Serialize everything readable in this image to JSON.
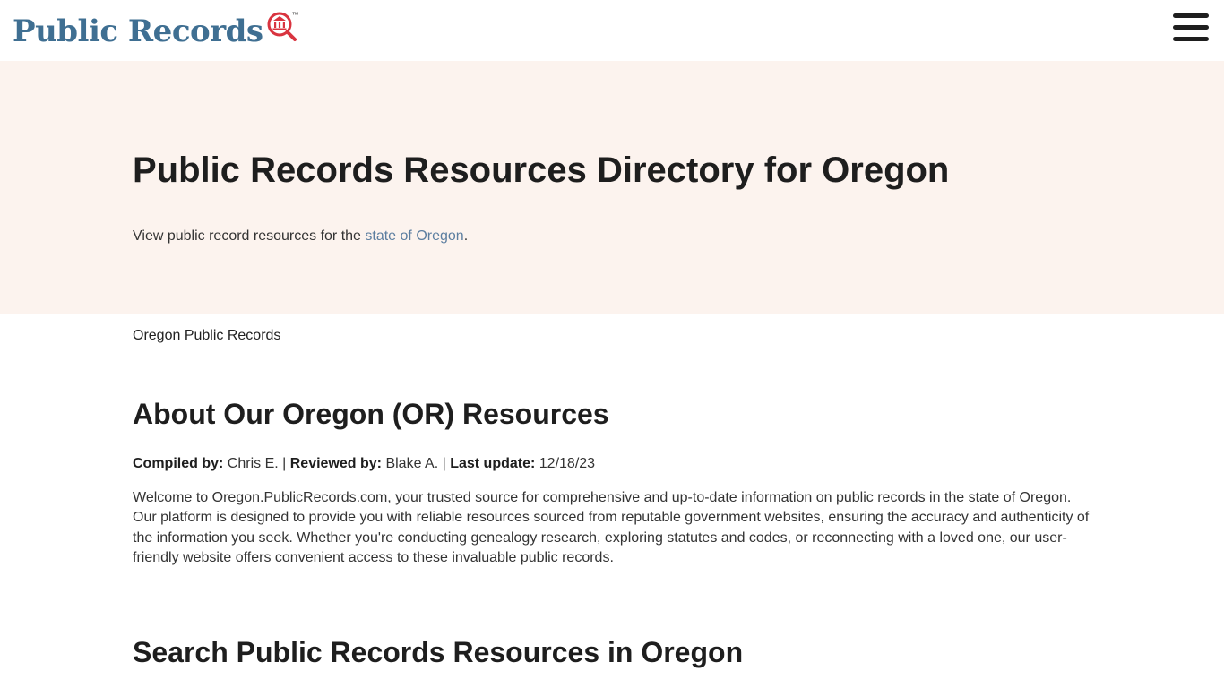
{
  "header": {
    "logo_text": "Public Records",
    "logo_tm": "™",
    "logo_icon": "magnifier-courthouse-icon",
    "menu_icon": "hamburger-icon"
  },
  "hero": {
    "title": "Public Records Resources Directory for Oregon",
    "description_prefix": "View public record resources for the ",
    "description_link": "state of Oregon",
    "description_suffix": "."
  },
  "breadcrumb": {
    "label": "Oregon Public Records"
  },
  "about": {
    "heading": "About Our Oregon (OR) Resources",
    "compiled_label": "Compiled by:",
    "compiled_value": " Chris E. | ",
    "reviewed_label": "Reviewed by:",
    "reviewed_value": " Blake A. | ",
    "updated_label": "Last update:",
    "updated_value": " 12/18/23",
    "intro": "Welcome to Oregon.PublicRecords.com, your trusted source for comprehensive and up-to-date information on public records in the state of Oregon. Our platform is designed to provide you with reliable resources sourced from reputable government websites, ensuring the accuracy and authenticity of the information you seek. Whether you're conducting genealogy research, exploring statutes and codes, or reconnecting with a loved one, our user-friendly website offers convenient access to these invaluable public records."
  },
  "search": {
    "heading": "Search Public Records Resources in Oregon"
  },
  "colors": {
    "logo_blue": "#3f6f92",
    "logo_red": "#d9343f",
    "hero_background": "#fcf3ee",
    "link": "#5c7ea0",
    "heading": "#1e1e1e"
  }
}
